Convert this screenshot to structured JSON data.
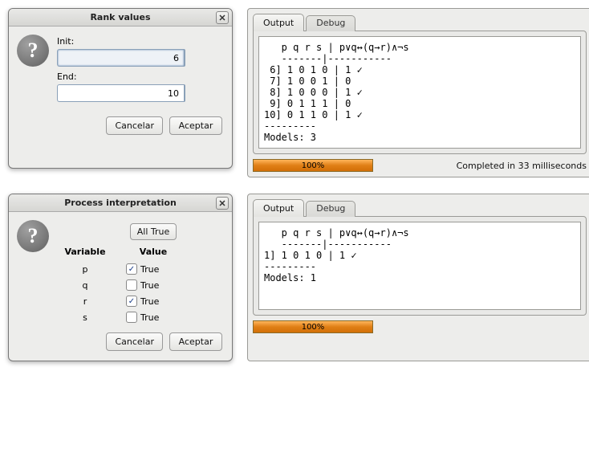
{
  "rank_dialog": {
    "title": "Rank values",
    "init_label": "Init:",
    "init_value": "6",
    "end_label": "End:",
    "end_value": "10",
    "cancel": "Cancelar",
    "accept": "Aceptar"
  },
  "process_dialog": {
    "title": "Process interpretation",
    "all_true": "All True",
    "col_variable": "Variable",
    "col_value": "Value",
    "rows": [
      {
        "name": "p",
        "checked": true,
        "label": "True"
      },
      {
        "name": "q",
        "checked": false,
        "label": "True"
      },
      {
        "name": "r",
        "checked": true,
        "label": "True"
      },
      {
        "name": "s",
        "checked": false,
        "label": "True"
      }
    ],
    "cancel": "Cancelar",
    "accept": "Aceptar"
  },
  "output_top": {
    "tab_output": "Output",
    "tab_debug": "Debug",
    "console": "   p q r s | p∨q↔(q→r)∧¬s\n   -------|-----------\n 6] 1 0 1 0 | 1 ✓\n 7] 1 0 0 1 | 0\n 8] 1 0 0 0 | 1 ✓\n 9] 0 1 1 1 | 0\n10] 0 1 1 0 | 1 ✓\n---------\nModels: 3",
    "progress": "100%",
    "status": "Completed in 33 milliseconds"
  },
  "output_bottom": {
    "tab_output": "Output",
    "tab_debug": "Debug",
    "console": "   p q r s | p∨q↔(q→r)∧¬s\n   -------|-----------\n1] 1 0 1 0 | 1 ✓\n---------\nModels: 1",
    "progress": "100%",
    "status": ""
  }
}
